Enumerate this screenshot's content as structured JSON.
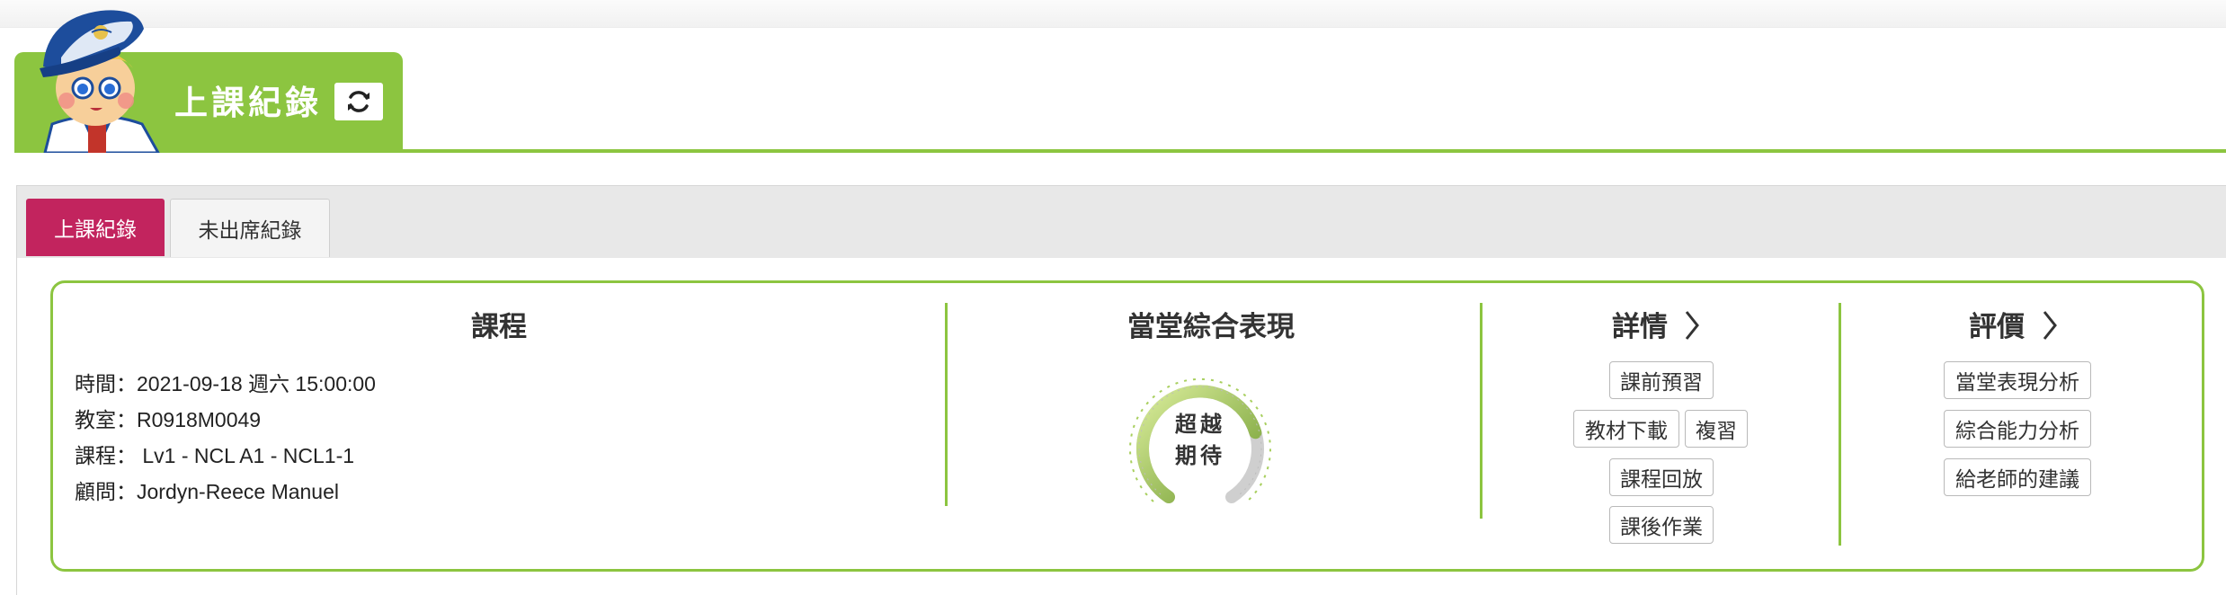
{
  "header": {
    "page_title": "上課紀錄",
    "refresh_icon": "refresh-icon",
    "mascot": "pilot-mascot"
  },
  "tabs": [
    {
      "label": "上課紀錄",
      "active": true
    },
    {
      "label": "未出席紀錄",
      "active": false
    }
  ],
  "course": {
    "title": "課程",
    "rows": [
      {
        "label": "時間：",
        "value": "2021-09-18 週六 15:00:00"
      },
      {
        "label": "教室：",
        "value": "R0918M0049"
      },
      {
        "label": "課程：",
        "value": " Lv1 - NCL A1 - NCL1-1"
      },
      {
        "label": "顧問：",
        "value": "Jordyn-Reece Manuel"
      }
    ]
  },
  "performance": {
    "title": "當堂綜合表現",
    "gauge_line1": "超越",
    "gauge_line2": "期待",
    "gauge_level": 0.75
  },
  "details": {
    "title": "詳情",
    "buttons": {
      "preview": "課前預習",
      "download": "教材下載",
      "review": "複習",
      "replay": "課程回放",
      "homework": "課後作業"
    }
  },
  "evaluation": {
    "title": "評價",
    "buttons": {
      "class_analysis": "當堂表現分析",
      "ability_analysis": "綜合能力分析",
      "advice": "給老師的建議"
    }
  },
  "colors": {
    "accent_green": "#8cc540",
    "active_tab": "#c2245e",
    "tab_bar": "#e8e8e8"
  }
}
